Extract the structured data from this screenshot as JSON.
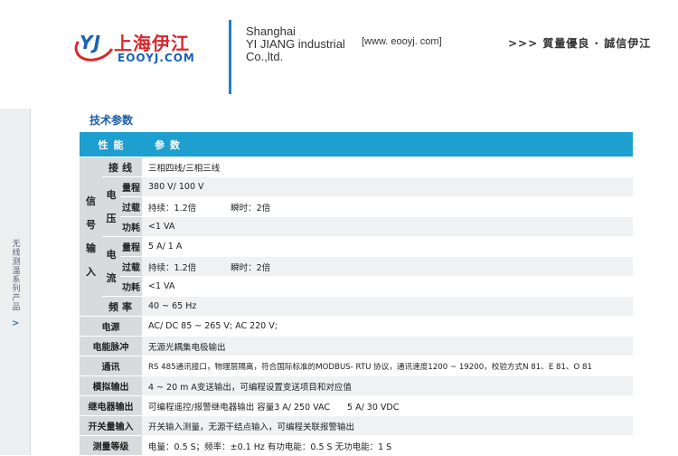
{
  "header": {
    "logo_mark": "YJ",
    "logo_cn": "上海伊江",
    "logo_en": "EOOYJ.COM",
    "company_lines": [
      "Shanghai",
      "YI JIANG industrial",
      "Co.,ltd."
    ],
    "website": "[www. eooyj. com]",
    "slogan": ">>> 質量優良 · 誠信伊江"
  },
  "sidebar": {
    "text": "无线测温系列产品",
    "arrow": ">"
  },
  "section_title": "技术参数",
  "table": {
    "head": [
      "性能",
      "参数"
    ],
    "signal_input": {
      "group_label": "信号输入",
      "wiring": {
        "label": "接线",
        "value": "三相四线/三相三线"
      },
      "voltage": {
        "label": "电压",
        "range": {
          "label": "量程",
          "value": "380 V/ 100 V"
        },
        "overload": {
          "label": "过载",
          "value_a": "持续：1.2倍",
          "value_b": "瞬时：2倍"
        },
        "power": {
          "label": "功耗",
          "value": "<1 VA"
        }
      },
      "current": {
        "label": "电流",
        "range": {
          "label": "量程",
          "value": "5 A/ 1 A"
        },
        "overload": {
          "label": "过载",
          "value_a": "持续：1.2倍",
          "value_b": "瞬时：2倍"
        },
        "power": {
          "label": "功耗",
          "value": "<1 VA"
        }
      },
      "frequency": {
        "label": "频率",
        "value": "40 ~ 65 Hz"
      }
    },
    "rows": [
      {
        "label": "电源",
        "value": "AC/ DC 85 ~ 265 V; AC 220 V;"
      },
      {
        "label": "电能脉冲",
        "value": "无源光耦集电极输出"
      },
      {
        "label": "通讯",
        "value": "RS 485通讯接口，物理层隔离，符合国际标准的MODBUS- RTU 协议，通讯速度1200 ~ 19200，校验方式N 81、E 81、O 81"
      },
      {
        "label": "模拟输出",
        "value": "4 ~ 20 m A变送输出，可编程设置变送项目和对应值"
      },
      {
        "label": "继电器输出",
        "value": "可编程遥控/报警继电器输出 容量3 A/ 250 VAC　　5 A/ 30 VDC"
      },
      {
        "label": "开关量输入",
        "value": "开关输入测量，无源干结点输入，可编程关联报警输出"
      },
      {
        "label": "测量等级",
        "value": "电量：0.5 S；频率：±0.1 Hz 有功电能：0.5 S 无功电能：1 S"
      }
    ]
  }
}
